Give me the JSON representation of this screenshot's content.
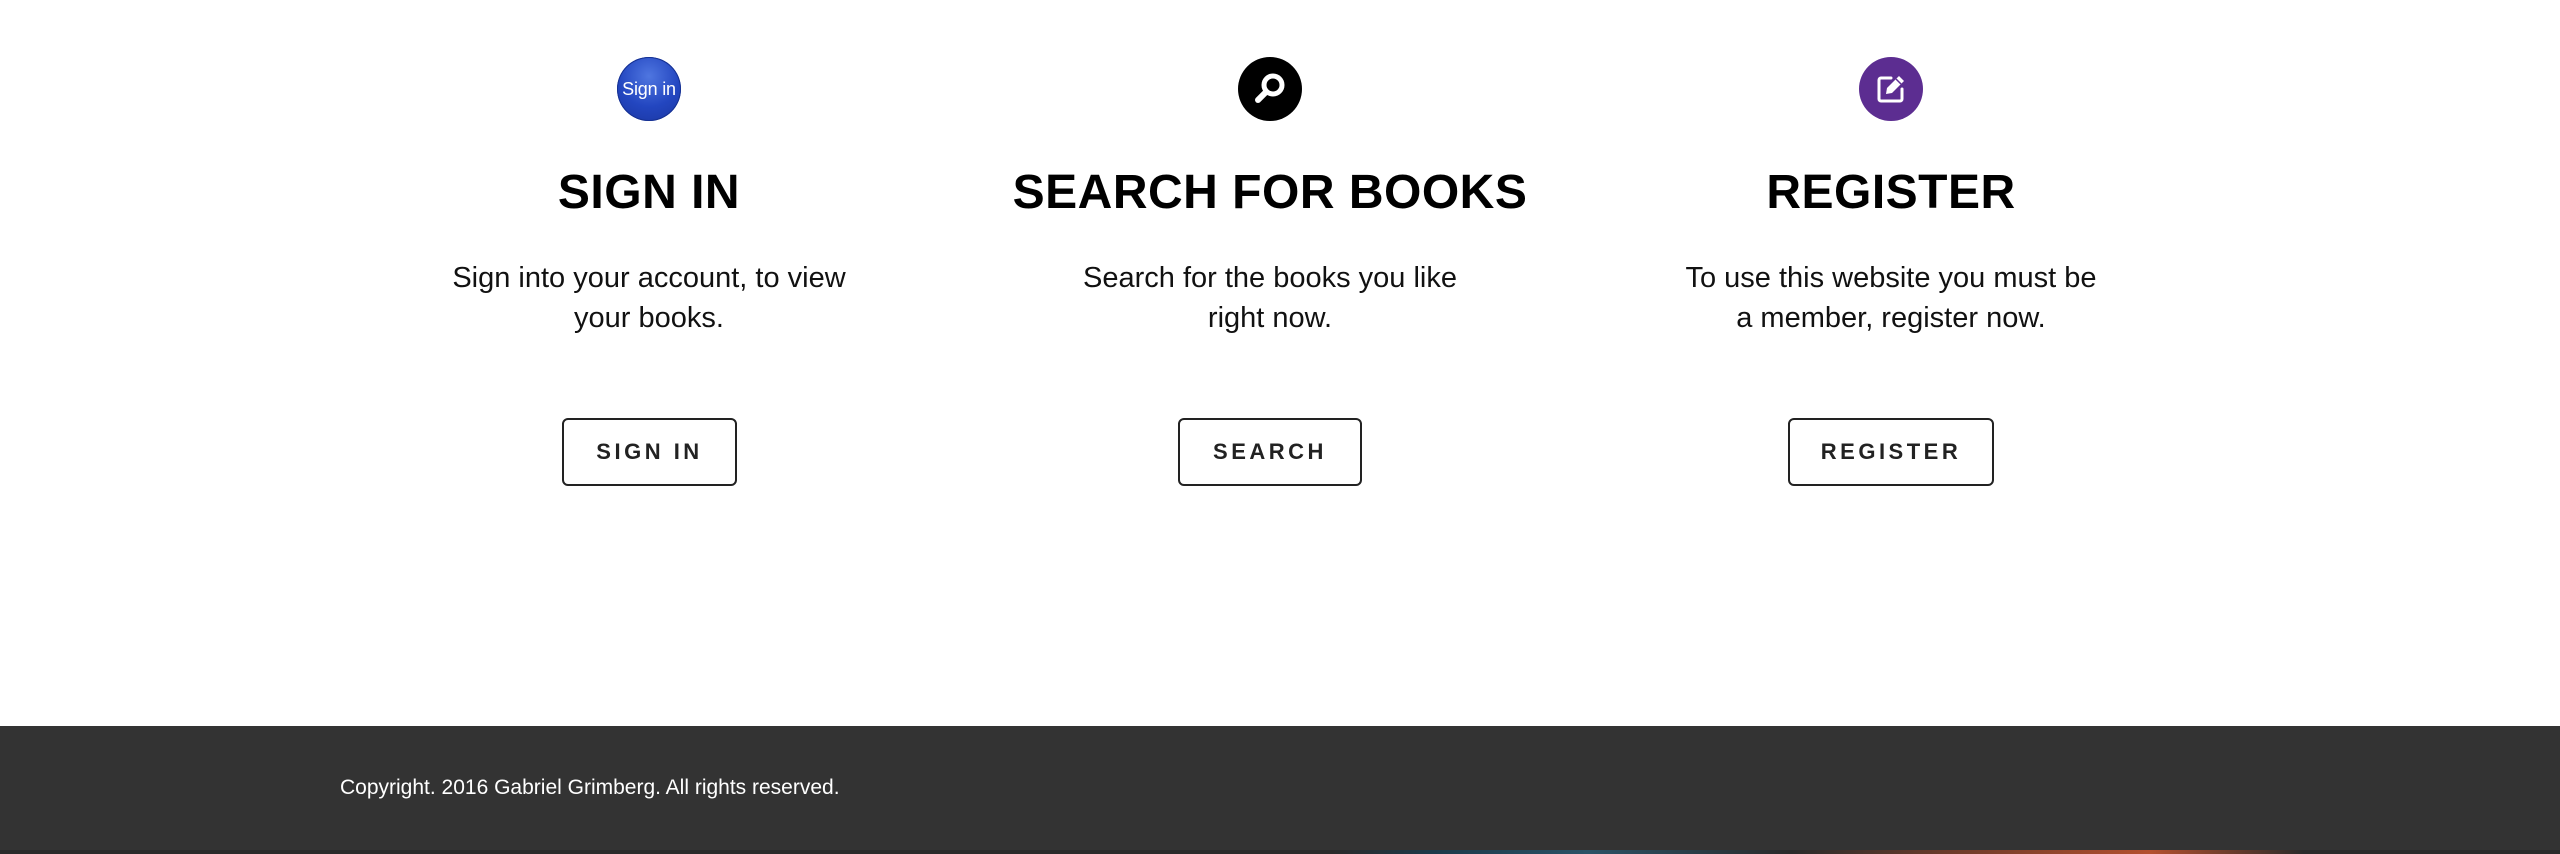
{
  "features": [
    {
      "icon": "sign-in-badge-icon",
      "icon_text": "Sign in",
      "title": "SIGN IN",
      "description": "Sign into your account, to view your books.",
      "button_label": "SIGN IN"
    },
    {
      "icon": "magnifier-icon",
      "title": "SEARCH FOR BOOKS",
      "description": "Search for the books you like right now.",
      "button_label": "SEARCH"
    },
    {
      "icon": "edit-pencil-icon",
      "title": "REGISTER",
      "description": "To use this website you must be a member, register now.",
      "button_label": "REGISTER"
    }
  ],
  "footer": {
    "copyright": "Copyright. 2016 Gabriel Grimberg. All rights reserved."
  },
  "colors": {
    "sign_in_icon": "#2346c0",
    "search_icon": "#000000",
    "register_icon": "#5c2d91",
    "footer_bg": "#333333"
  }
}
